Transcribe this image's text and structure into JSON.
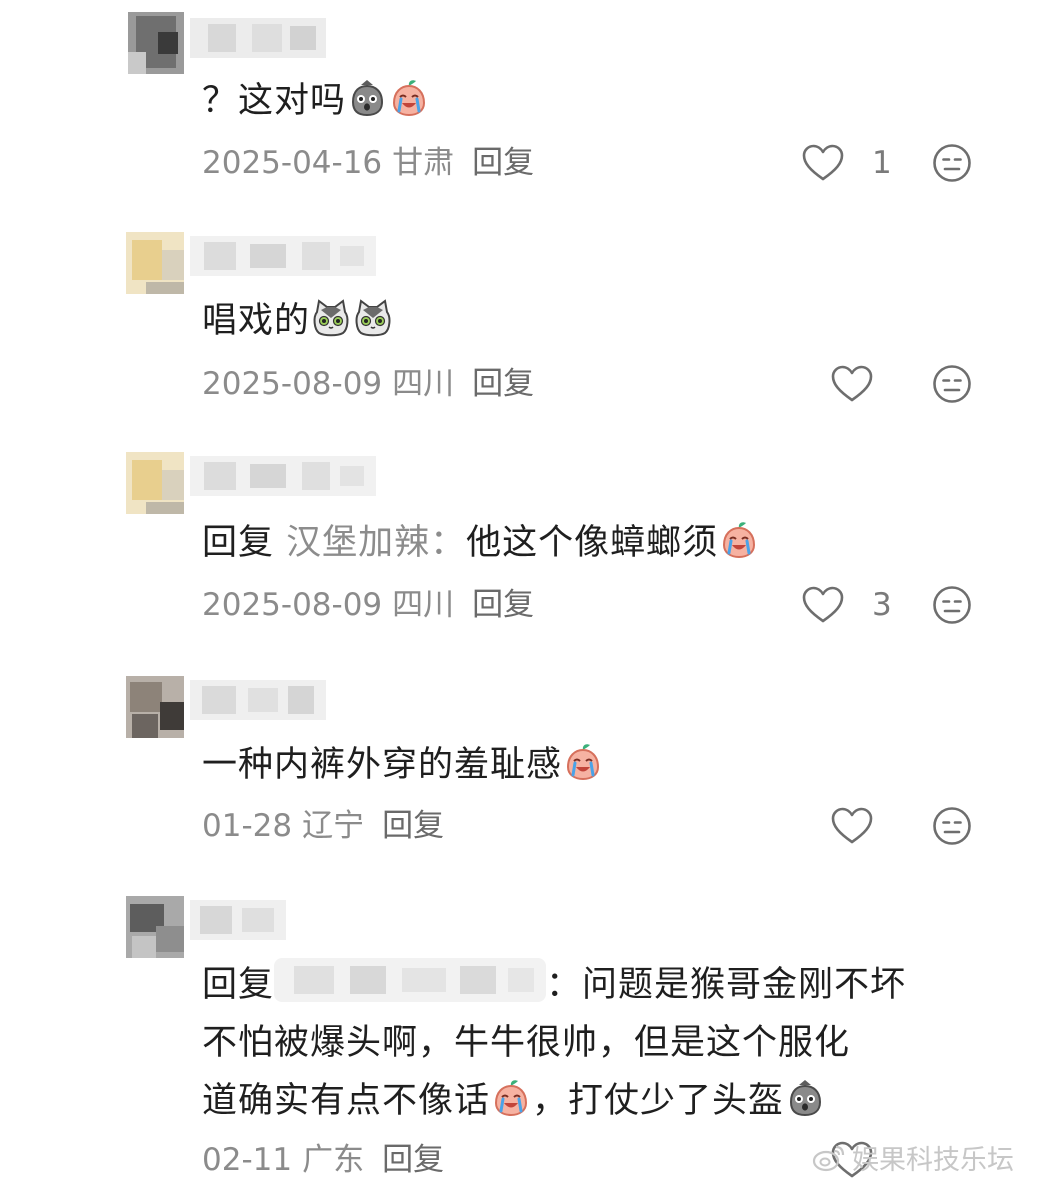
{
  "comments": [
    {
      "body": "？这对吗",
      "date": "2025-04-16",
      "region": "甘肃",
      "reply_label": "回复",
      "likes": "1"
    },
    {
      "body": "唱戏的",
      "date": "2025-08-09",
      "region": "四川",
      "reply_label": "回复",
      "likes": ""
    },
    {
      "reply_prefix": "回复",
      "reply_to": "汉堡加辣：",
      "body": "他这个像蟑螂须",
      "date": "2025-08-09",
      "region": "四川",
      "reply_label": "回复",
      "likes": "3"
    },
    {
      "body": "一种内裤外穿的羞耻感",
      "date": "01-28",
      "region": "辽宁",
      "reply_label": "回复",
      "likes": ""
    },
    {
      "reply_prefix": "回复",
      "reply_to": "：",
      "line1": "问题是猴哥金刚不坏",
      "line2": "不怕被爆头啊，牛牛很帅，但是这个服化",
      "line3a": "道确实有点不像话",
      "line3b": "，打仗少了头盔",
      "date": "02-11",
      "region": "广东",
      "reply_label": "回复",
      "likes": ""
    }
  ],
  "watermark": "娱果科技乐坛",
  "colors": {
    "text": "#1f1f1f",
    "meta": "#8b8b8b",
    "icon": "#6e6e6e"
  }
}
